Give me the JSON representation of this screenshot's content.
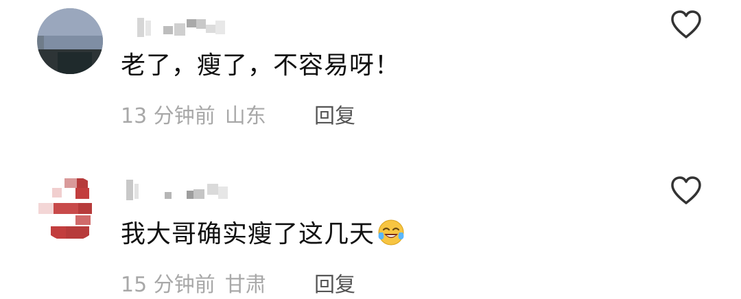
{
  "comments": [
    {
      "text": "老了，瘦了，不容易呀！",
      "time": "13 分钟前",
      "location": "山东",
      "reply_label": "回复",
      "like_icon": "heart-outline-icon"
    },
    {
      "text": "我大哥确实瘦了这几天",
      "emoji": "crying-laughing-emoji-icon",
      "time": "15 分钟前",
      "location": "甘肃",
      "reply_label": "回复",
      "like_icon": "heart-outline-icon"
    }
  ],
  "colors": {
    "text": "#111111",
    "meta": "#a8a8a8",
    "reply": "#555555",
    "icon": "#333333"
  }
}
